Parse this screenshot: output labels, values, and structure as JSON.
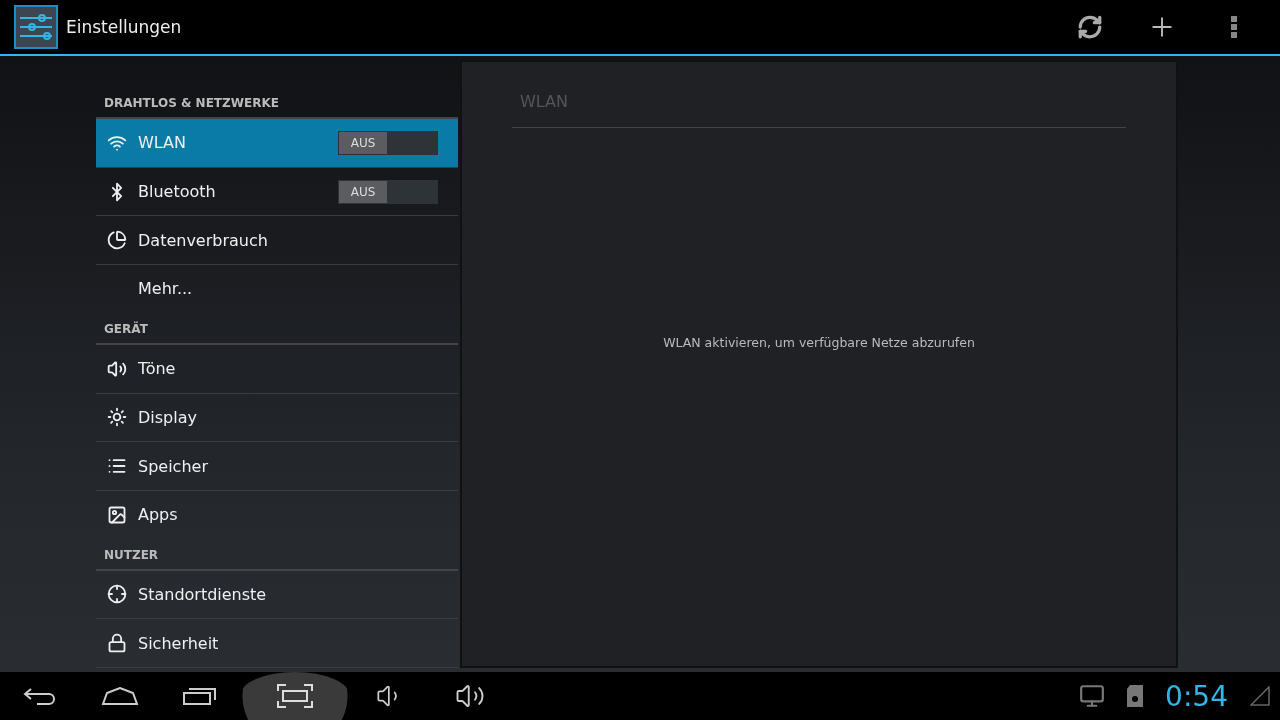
{
  "action_bar": {
    "title": "Einstellungen"
  },
  "sections": [
    {
      "header": "DRAHTLOS & NETZWERKE",
      "items": [
        {
          "label": "WLAN",
          "selected": true,
          "kind": "switch",
          "switch": {
            "label": "AUS",
            "on": false
          }
        },
        {
          "label": "Bluetooth",
          "selected": false,
          "kind": "switch",
          "switch": {
            "label": "AUS",
            "on": false
          }
        },
        {
          "label": "Datenverbrauch",
          "selected": false,
          "kind": "plain"
        },
        {
          "label": "Mehr...",
          "selected": false,
          "kind": "plain"
        }
      ]
    },
    {
      "header": "GERÄT",
      "items": [
        {
          "label": "Töne",
          "selected": false,
          "kind": "plain"
        },
        {
          "label": "Display",
          "selected": false,
          "kind": "plain"
        },
        {
          "label": "Speicher",
          "selected": false,
          "kind": "plain"
        },
        {
          "label": "Apps",
          "selected": false,
          "kind": "plain"
        }
      ]
    },
    {
      "header": "NUTZER",
      "items": [
        {
          "label": "Standortdienste",
          "selected": false,
          "kind": "plain"
        },
        {
          "label": "Sicherheit",
          "selected": false,
          "kind": "plain"
        }
      ]
    }
  ],
  "detail": {
    "title": "WLAN",
    "message": "WLAN aktivieren, um verfügbare Netze abzurufen"
  },
  "nav_buttons": [
    {
      "pressed": false
    },
    {
      "pressed": false
    },
    {
      "pressed": false
    },
    {
      "pressed": true
    },
    {
      "pressed": false
    },
    {
      "pressed": false
    }
  ],
  "status": {
    "clock": "0:54"
  }
}
